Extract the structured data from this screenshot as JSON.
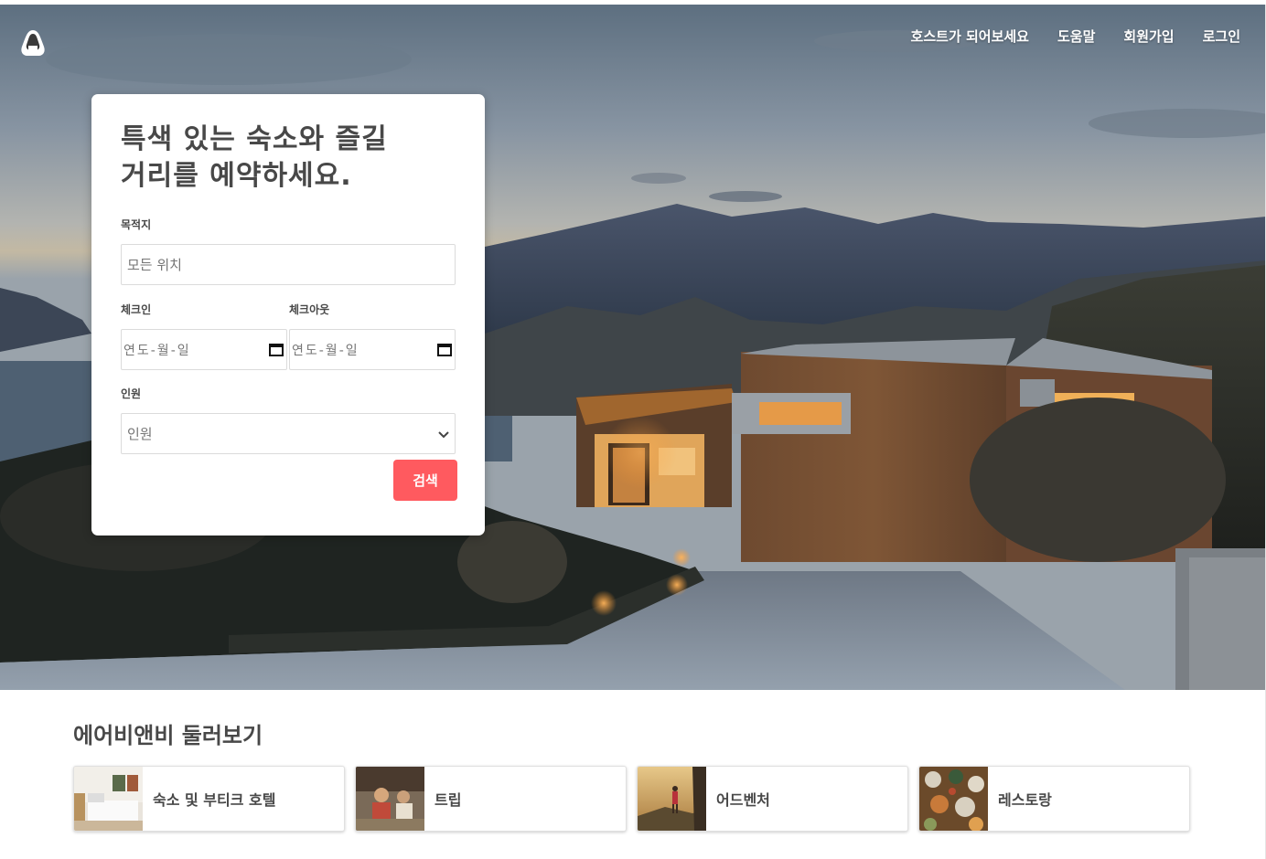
{
  "nav": {
    "links": [
      "호스트가 되어보세요",
      "도움말",
      "회원가입",
      "로그인"
    ]
  },
  "search": {
    "headline": "특색 있는 숙소와 즐길 거리를 예약하세요.",
    "destination_label": "목적지",
    "destination_placeholder": "모든 위치",
    "checkin_label": "체크인",
    "checkout_label": "체크아웃",
    "date_placeholder": "연도-월-일",
    "guests_label": "인원",
    "guests_value": "인원",
    "search_button": "검색"
  },
  "explore": {
    "title": "에어비앤비 둘러보기",
    "items": [
      {
        "label": "숙소 및 부티크 호텔",
        "icon": "bedroom-photo"
      },
      {
        "label": "트립",
        "icon": "cooking-class-photo"
      },
      {
        "label": "어드벤처",
        "icon": "hiker-sunset-photo"
      },
      {
        "label": "레스토랑",
        "icon": "food-table-photo"
      }
    ]
  },
  "colors": {
    "accent": "#ff5a5f",
    "text": "#484848",
    "border": "#dbdbdb"
  }
}
